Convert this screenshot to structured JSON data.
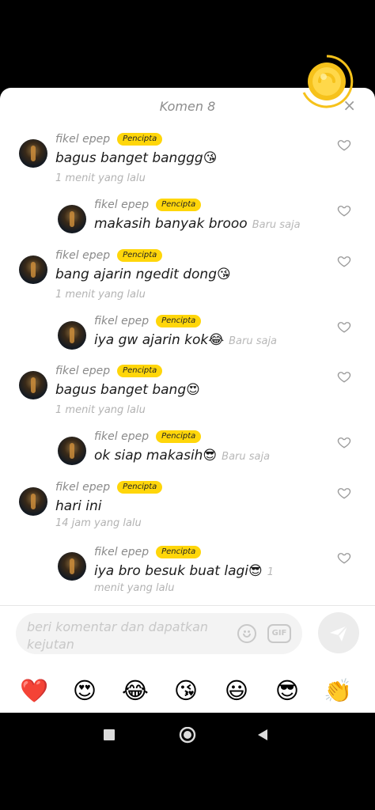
{
  "sheet": {
    "title": "Komen 8",
    "close_glyph": "×"
  },
  "comments": [
    {
      "user": "fikel epep",
      "badge": "Pencipta",
      "text": "bagus banget banggg😘",
      "time": "1 menit yang lalu",
      "reply": false
    },
    {
      "user": "fikel epep",
      "badge": "Pencipta",
      "text": "makasih banyak brooo",
      "time": "Baru saja",
      "reply": true
    },
    {
      "user": "fikel epep",
      "badge": "Pencipta",
      "text": "bang ajarin ngedit dong😘",
      "time": "1 menit yang lalu",
      "reply": false
    },
    {
      "user": "fikel epep",
      "badge": "Pencipta",
      "text": "iya gw ajarin kok😂",
      "time": "Baru saja",
      "reply": true
    },
    {
      "user": "fikel epep",
      "badge": "Pencipta",
      "text": "bagus banget bang😍",
      "time": "1 menit yang lalu",
      "reply": false
    },
    {
      "user": "fikel epep",
      "badge": "Pencipta",
      "text": "ok siap makasih😎",
      "time": "Baru saja",
      "reply": true
    },
    {
      "user": "fikel epep",
      "badge": "Pencipta",
      "text": "hari ini",
      "time": "14 jam yang lalu",
      "reply": false
    },
    {
      "user": "fikel epep",
      "badge": "Pencipta",
      "text": "iya bro besuk buat lagi😎",
      "time_inline": "1",
      "time": "menit yang lalu",
      "reply": true
    }
  ],
  "composer": {
    "placeholder": "beri komentar dan dapatkan kejutan",
    "gif_label": "GIF"
  },
  "quick_emojis": [
    "❤️",
    "😍",
    "😂",
    "😘",
    "😃",
    "😎",
    "👏"
  ],
  "icons": {
    "heart": "heart-outline-icon",
    "send": "send-icon",
    "emoji": "smiley-icon",
    "gif": "gif-icon",
    "coin": "gold-coin-reward-icon",
    "nav_recent": "square-icon",
    "nav_home": "circle-icon",
    "nav_back": "triangle-back-icon"
  },
  "colors": {
    "badge": "#ffd60a",
    "coin_gold": "#f6c21b"
  }
}
